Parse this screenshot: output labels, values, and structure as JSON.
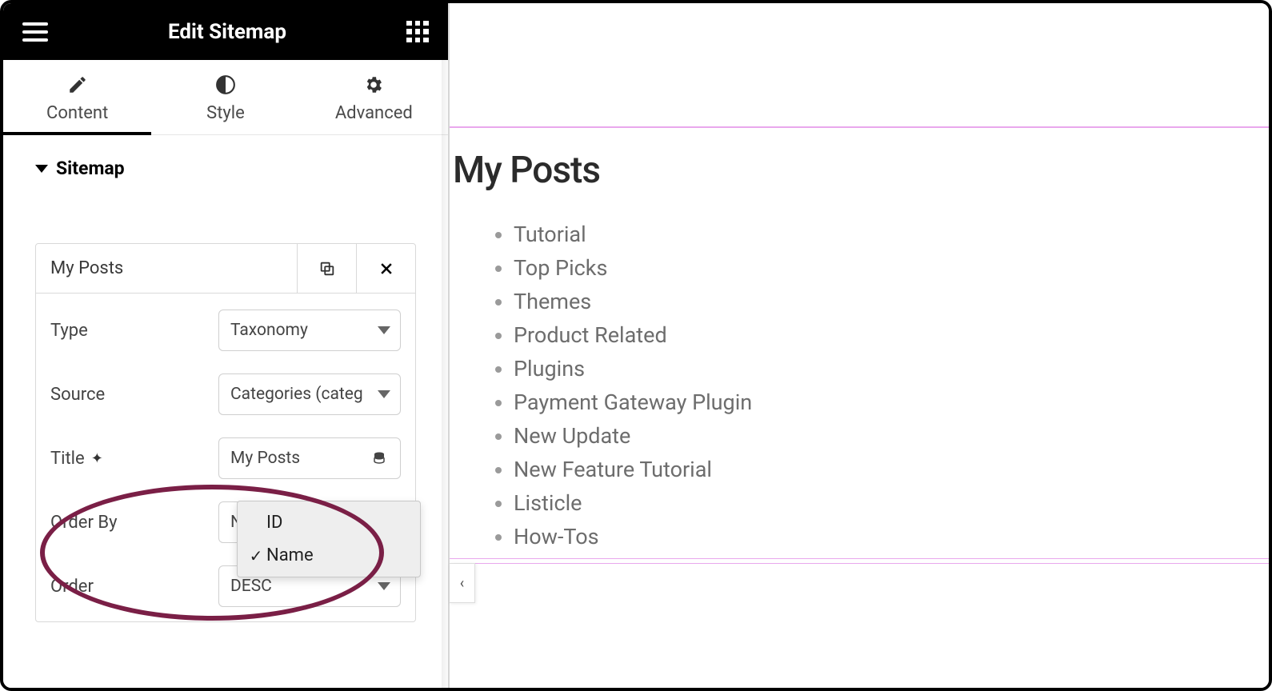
{
  "header": {
    "title": "Edit Sitemap"
  },
  "tabs": {
    "content": "Content",
    "style": "Style",
    "advanced": "Advanced",
    "active": "content"
  },
  "section": {
    "title": "Sitemap"
  },
  "item": {
    "title": "My Posts",
    "fields": {
      "type": {
        "label": "Type",
        "value": "Taxonomy"
      },
      "source": {
        "label": "Source",
        "value": "Categories (categ"
      },
      "title": {
        "label": "Title",
        "value": "My Posts"
      },
      "orderby": {
        "label": "Order By",
        "value": "Name",
        "options": [
          "ID",
          "Name"
        ],
        "selected": "Name"
      },
      "order": {
        "label": "Order",
        "value": "DESC"
      }
    }
  },
  "preview": {
    "heading": "My Posts",
    "items": [
      "Tutorial",
      "Top Picks",
      "Themes",
      "Product Related",
      "Plugins",
      "Payment Gateway Plugin",
      "New Update",
      "New Feature Tutorial",
      "Listicle",
      "How-Tos"
    ]
  },
  "collapse_glyph": "‹"
}
